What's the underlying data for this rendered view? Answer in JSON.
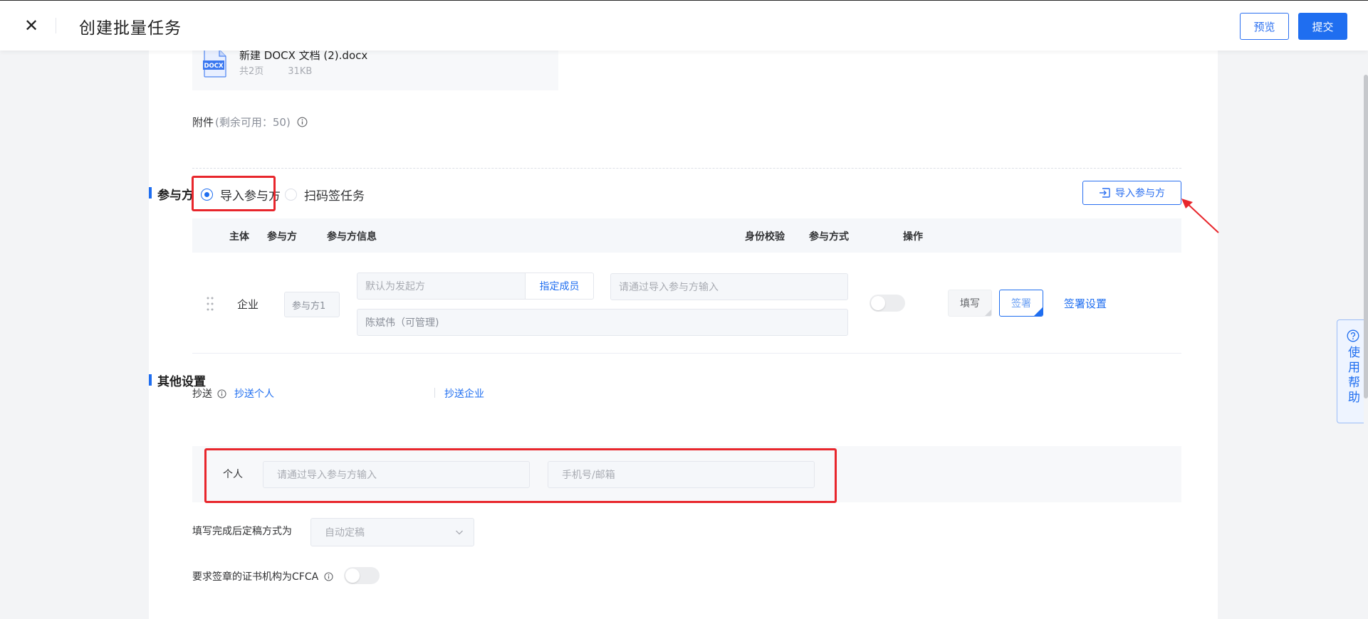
{
  "header": {
    "title": "创建批量任务",
    "close_glyph": "✕",
    "preview_label": "预览",
    "submit_label": "提交"
  },
  "document": {
    "name": "新建 DOCX 文档 (2).docx",
    "pages": "共2页",
    "size": "31KB",
    "icon": "docx-file-icon",
    "icon_text": "DOCX"
  },
  "attachment": {
    "label": "附件",
    "remaining": "(剩余可用：50)"
  },
  "participants": {
    "section_title": "参与方",
    "mode_options": [
      {
        "label": "导入参与方",
        "selected": true
      },
      {
        "label": "扫码签任务",
        "selected": false
      }
    ],
    "import_button": "导入参与方",
    "columns": [
      "主体",
      "参与方",
      "参与方信息",
      "身份校验",
      "参与方式",
      "操作"
    ],
    "rows": [
      {
        "entity": "企业",
        "party": "参与方1",
        "info_default": "默认为发起方",
        "assign_member": "指定成员",
        "info_input_placeholder": "请通过导入参与方输入",
        "manager": "陈斌伟（可管理)",
        "identity_check": false,
        "modes": [
          "填写",
          "签署"
        ],
        "action": "签署设置"
      }
    ]
  },
  "other_settings": {
    "section_title": "其他设置",
    "cc_label": "抄送",
    "cc_person_link": "抄送个人",
    "cc_company_link": "抄送企业",
    "cc_entry": {
      "type_label": "个人",
      "name_placeholder": "请通过导入参与方输入",
      "contact_placeholder": "手机号/邮箱"
    },
    "finalize_label": "填写完成后定稿方式为",
    "finalize_value": "自动定稿",
    "cfca_label": "要求签章的证书机构为CFCA",
    "cfca_enabled": false
  },
  "help": {
    "label": "使用帮助"
  },
  "colors": {
    "accent": "#1f6ef0",
    "highlight": "#e8262c"
  }
}
